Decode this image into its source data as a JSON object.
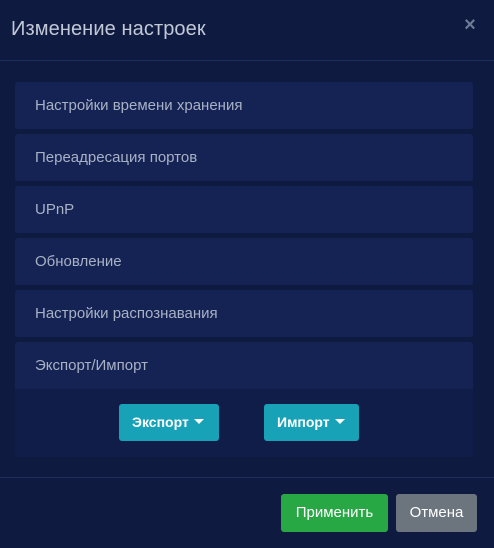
{
  "dialog": {
    "title": "Изменение настроек",
    "close_glyph": "×"
  },
  "accordion": {
    "items": [
      {
        "label": "Настройки времени хранения"
      },
      {
        "label": "Переадресация портов"
      },
      {
        "label": "UPnP"
      },
      {
        "label": "Обновление"
      },
      {
        "label": "Настройки распознавания"
      },
      {
        "label": "Экспорт/Импорт",
        "expanded": true
      }
    ],
    "export_import_panel": {
      "export_label": "Экспорт",
      "import_label": "Импорт"
    }
  },
  "footer": {
    "apply_label": "Применить",
    "cancel_label": "Отмена"
  },
  "colors": {
    "background": "#0e1a40",
    "item_background": "#152354",
    "accent_info": "#17a2b8",
    "success": "#28a745",
    "secondary": "#6c757d"
  },
  "icons": {
    "close": "close-icon",
    "dropdown": "caret-down-icon"
  }
}
